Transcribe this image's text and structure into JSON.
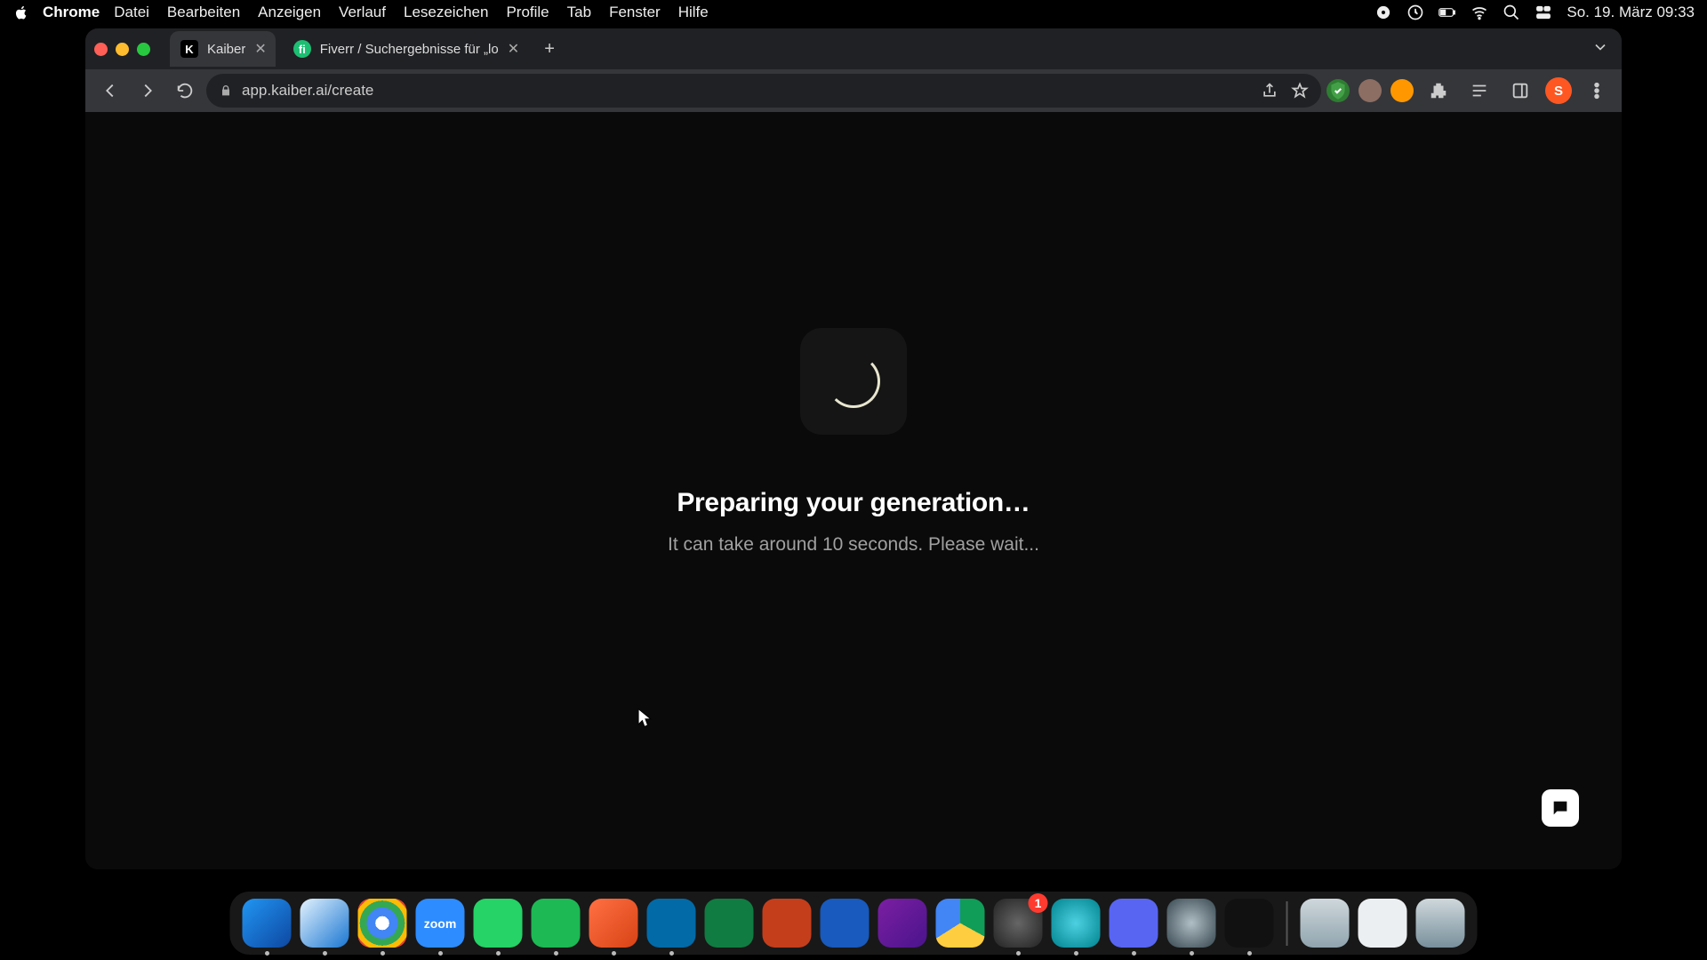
{
  "menubar": {
    "app_name": "Chrome",
    "items": [
      "Datei",
      "Bearbeiten",
      "Anzeigen",
      "Verlauf",
      "Lesezeichen",
      "Profile",
      "Tab",
      "Fenster",
      "Hilfe"
    ],
    "clock": "So. 19. März  09:33"
  },
  "tabs": [
    {
      "title": "Kaiber",
      "active": true,
      "fav_letter": "K",
      "fav_bg": "#000",
      "fav_fg": "#fff"
    },
    {
      "title": "Fiverr / Suchergebnisse für „lo",
      "active": false,
      "fav_letter": "fi",
      "fav_bg": "#1dbf73",
      "fav_fg": "#fff"
    }
  ],
  "omnibox": {
    "url": "app.kaiber.ai/create"
  },
  "toolbar_avatar": {
    "letter": "S",
    "bg": "#ff5722",
    "fg": "#fff"
  },
  "extensions": [
    {
      "name": "ext-shield",
      "bg": "#2e7d32"
    },
    {
      "name": "ext-orange1",
      "bg": "#8d6e63"
    },
    {
      "name": "ext-orange2",
      "bg": "#ff9800"
    }
  ],
  "page": {
    "heading": "Preparing your generation…",
    "subtitle": "It can take around 10 seconds. Please wait..."
  },
  "dock": {
    "apps": [
      {
        "name": "finder",
        "bg": "linear-gradient(135deg,#2196f3,#0d47a1)",
        "dot": true
      },
      {
        "name": "safari",
        "bg": "linear-gradient(135deg,#e3f2fd,#1976d2)",
        "dot": true
      },
      {
        "name": "chrome",
        "bg": "radial-gradient(circle at 50% 50%, #fff 0 20%, #4285f4 20% 45%, #34a853 45% 65%, #fbbc05 65% 80%, #ea4335 80%)",
        "dot": true
      },
      {
        "name": "zoom",
        "bg": "#2d8cff",
        "dot": true,
        "label": "zoom"
      },
      {
        "name": "whatsapp",
        "bg": "#25d366",
        "dot": true
      },
      {
        "name": "spotify",
        "bg": "#1db954",
        "dot": true
      },
      {
        "name": "todoist",
        "bg": "linear-gradient(135deg,#ff7043,#d84315)",
        "dot": true
      },
      {
        "name": "trello",
        "bg": "#026aa7",
        "dot": true
      },
      {
        "name": "excel",
        "bg": "#107c41",
        "dot": false
      },
      {
        "name": "powerpoint",
        "bg": "#c43e1c",
        "dot": false
      },
      {
        "name": "word",
        "bg": "#185abd",
        "dot": false
      },
      {
        "name": "imovie",
        "bg": "linear-gradient(135deg,#7b1fa2,#4a148c)",
        "dot": false
      },
      {
        "name": "drive",
        "bg": "conic-gradient(#0f9d58 0 33%, #ffcd40 33% 66%, #4285f4 66%)",
        "dot": false
      },
      {
        "name": "settings",
        "bg": "radial-gradient(circle,#666,#222)",
        "dot": true,
        "badge": "1"
      },
      {
        "name": "cyan-app",
        "bg": "radial-gradient(circle,#4dd0e1,#00838f)",
        "dot": true
      },
      {
        "name": "discord",
        "bg": "#5865f2",
        "dot": true
      },
      {
        "name": "quicktime",
        "bg": "radial-gradient(circle,#b0bec5,#37474f)",
        "dot": true
      },
      {
        "name": "voice-memos",
        "bg": "#111",
        "dot": true
      }
    ],
    "right": [
      {
        "name": "downloads",
        "bg": "linear-gradient(#cfd8dc,#90a4ae)"
      },
      {
        "name": "desktop-folder",
        "bg": "#eceff1"
      },
      {
        "name": "trash",
        "bg": "linear-gradient(#cfd8dc,#78909c)"
      }
    ]
  }
}
